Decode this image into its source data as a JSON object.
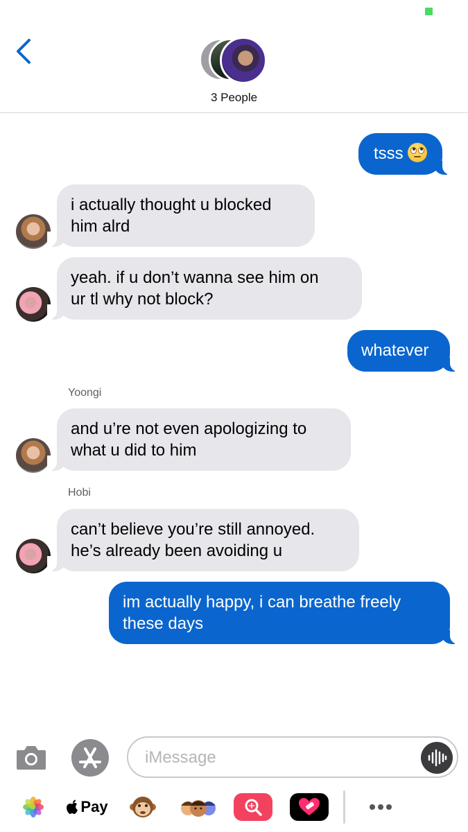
{
  "header": {
    "title": "3 People"
  },
  "messages": [
    {
      "type": "outgoing",
      "text": "tsss",
      "emoji": "face-with-rolling-eyes"
    },
    {
      "type": "incoming",
      "avatar": "avatar-yoongi",
      "text": "i actually thought u blocked\nhim alrd"
    },
    {
      "type": "incoming",
      "avatar": "avatar-hobi",
      "text": "yeah. if u don’t wanna see him on\nur tl why not block?"
    },
    {
      "type": "outgoing",
      "text": "whatever"
    },
    {
      "type": "incoming",
      "sender": "Yoongi",
      "avatar": "avatar-yoongi",
      "text": "and u’re not even apologizing to\nwhat u did to him"
    },
    {
      "type": "incoming",
      "sender": "Hobi",
      "avatar": "avatar-hobi",
      "text": "can’t believe you’re still annoyed.\nhe’s already been avoiding u"
    },
    {
      "type": "outgoing",
      "text": "im actually happy, i can breathe freely\nthese days"
    }
  ],
  "composer": {
    "placeholder": "iMessage",
    "value": ""
  },
  "app_strip": {
    "apple_pay_label": "Pay"
  },
  "icons": [
    "back-chevron-icon",
    "camera-icon",
    "app-store-icon",
    "audio-waveform-icon",
    "photos-icon",
    "apple-logo-icon",
    "monkey-emoji-icon",
    "memoji-icon",
    "search-app-icon",
    "heart-app-icon",
    "more-icon"
  ],
  "colors": {
    "outgoing_bubble": "#0a66ce",
    "incoming_bubble": "#e6e6eb",
    "accent": "#0a66ce"
  }
}
